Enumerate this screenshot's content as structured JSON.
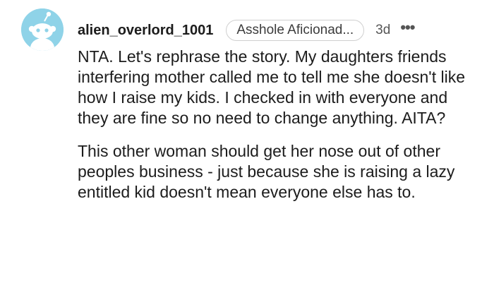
{
  "comment": {
    "author": "alien_overlord_1001",
    "flair": "Asshole Aficionad...",
    "age": "3d",
    "more_glyph": "•••",
    "avatar_icon": "reddit-snoo-avatar-icon",
    "colors": {
      "avatar_bg": "#8fd3e8",
      "text": "#1c1c1c",
      "muted": "#555555"
    },
    "paragraphs": [
      "NTA. Let's rephrase the story. My daughters friends interfering mother called me to tell me she doesn't like how I raise my kids. I checked in with everyone and they are fine so no need to change anything. AITA?",
      "This other woman should get her nose out of other peoples business - just because she is raising a lazy entitled kid doesn't mean everyone else has to."
    ]
  }
}
